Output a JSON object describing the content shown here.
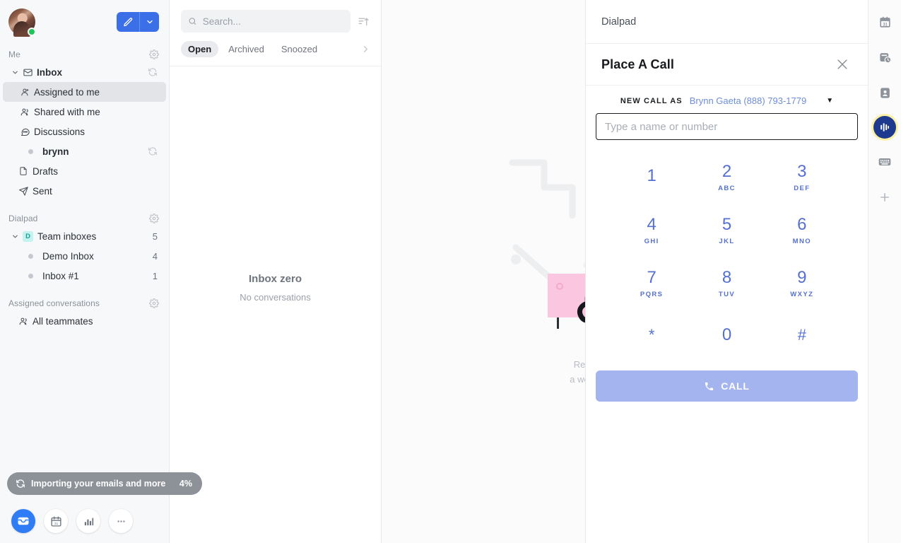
{
  "sidebar": {
    "avatar": {
      "name": "avatar",
      "status": "online"
    },
    "compose": {
      "label": "compose",
      "caret": "chevron-down-icon"
    },
    "sections": [
      {
        "label": "Me",
        "has_gear": true,
        "items": [
          {
            "label": "Inbox",
            "icon": "inbox-icon",
            "bold": true,
            "twisty": true,
            "sync": true,
            "indent": 0,
            "count": ""
          },
          {
            "label": "Assigned to me",
            "icon": "assigned-icon",
            "selected": true,
            "indent": 1,
            "count": ""
          },
          {
            "label": "Shared with me",
            "icon": "people-icon",
            "indent": 1,
            "count": ""
          },
          {
            "label": "Discussions",
            "icon": "chat-icon",
            "indent": 1,
            "count": ""
          },
          {
            "label": "brynn",
            "icon": "dot-icon",
            "bold": true,
            "sync": true,
            "indent": 1,
            "count": ""
          },
          {
            "label": "Drafts",
            "icon": "draft-icon",
            "indent": 0,
            "count": ""
          },
          {
            "label": "Sent",
            "icon": "send-icon",
            "indent": 0,
            "count": ""
          }
        ]
      },
      {
        "label": "Dialpad",
        "has_gear": true,
        "items": [
          {
            "label": "Team inboxes",
            "icon": "team-badge",
            "badge": "D",
            "twisty": true,
            "indent": 0,
            "count": "5"
          },
          {
            "label": "Demo Inbox",
            "icon": "dot-icon",
            "indent": 1,
            "count": "4"
          },
          {
            "label": "Inbox #1",
            "icon": "dot-icon",
            "indent": 1,
            "count": "1"
          }
        ]
      },
      {
        "label": "Assigned conversations",
        "has_gear": true,
        "items": [
          {
            "label": "All teammates",
            "icon": "people-icon",
            "indent": 0,
            "count": ""
          }
        ]
      }
    ],
    "toast": {
      "icon": "sync-icon",
      "text": "Importing your emails and more",
      "percent": "4%"
    },
    "dock": [
      {
        "name": "inbox",
        "icon": "inbox-icon",
        "active": true
      },
      {
        "name": "calendar",
        "icon": "calendar-icon",
        "active": false
      },
      {
        "name": "analytics",
        "icon": "bar-chart-icon",
        "active": false
      },
      {
        "name": "more",
        "icon": "ellipsis-icon",
        "active": false
      }
    ]
  },
  "list": {
    "search": {
      "placeholder": "Search...",
      "value": "",
      "icon": "search-icon"
    },
    "sort_icon": "sort-ascending-icon",
    "tabs": [
      {
        "label": "Open",
        "active": true
      },
      {
        "label": "Archived",
        "active": false
      },
      {
        "label": "Snoozed",
        "active": false
      }
    ],
    "tabs_more_icon": "chevron-right-icon",
    "empty": {
      "title": "Inbox zero",
      "subtitle": "No conversations"
    }
  },
  "canvas": {
    "illustration": "cat-on-desk-illustration",
    "caption_line1": "Re",
    "caption_line2": "a we"
  },
  "dialpad": {
    "header_title": "Dialpad",
    "panel_title": "Place A Call",
    "close_icon": "close-icon",
    "new_call_as": {
      "label": "NEW CALL AS",
      "value": "Brynn Gaeta (888) 793-1779",
      "caret": "▼"
    },
    "number_input": {
      "placeholder": "Type a name or number",
      "value": ""
    },
    "keys": [
      {
        "num": "1",
        "letters": ""
      },
      {
        "num": "2",
        "letters": "ABC"
      },
      {
        "num": "3",
        "letters": "DEF"
      },
      {
        "num": "4",
        "letters": "GHI"
      },
      {
        "num": "5",
        "letters": "JKL"
      },
      {
        "num": "6",
        "letters": "MNO"
      },
      {
        "num": "7",
        "letters": "PQRS"
      },
      {
        "num": "8",
        "letters": "TUV"
      },
      {
        "num": "9",
        "letters": "WXYZ"
      },
      {
        "num": "*",
        "letters": ""
      },
      {
        "num": "0",
        "letters": ""
      },
      {
        "num": "#",
        "letters": ""
      }
    ],
    "call_button": {
      "label": "CALL",
      "icon": "phone-icon"
    }
  },
  "rail": [
    {
      "name": "calendar",
      "icon": "calendar-31-icon",
      "active": false
    },
    {
      "name": "recent-calls",
      "icon": "clock-card-icon",
      "active": false
    },
    {
      "name": "contacts",
      "icon": "contact-card-icon",
      "active": false
    },
    {
      "name": "dialpad",
      "icon": "dialpad-logo-icon",
      "active": true
    },
    {
      "name": "keyboard",
      "icon": "keyboard-icon",
      "active": false
    },
    {
      "name": "add-app",
      "icon": "plus-icon",
      "active": false
    }
  ],
  "colors": {
    "accent_blue": "#3b6fe8",
    "keypad_blue": "#5570cf",
    "call_button": "#a3b4ef",
    "status_green": "#1ec65a",
    "team_badge_bg": "#c3f2ef",
    "team_badge_fg": "#1a9d95",
    "dialpad_navy": "#1e3a8f"
  }
}
